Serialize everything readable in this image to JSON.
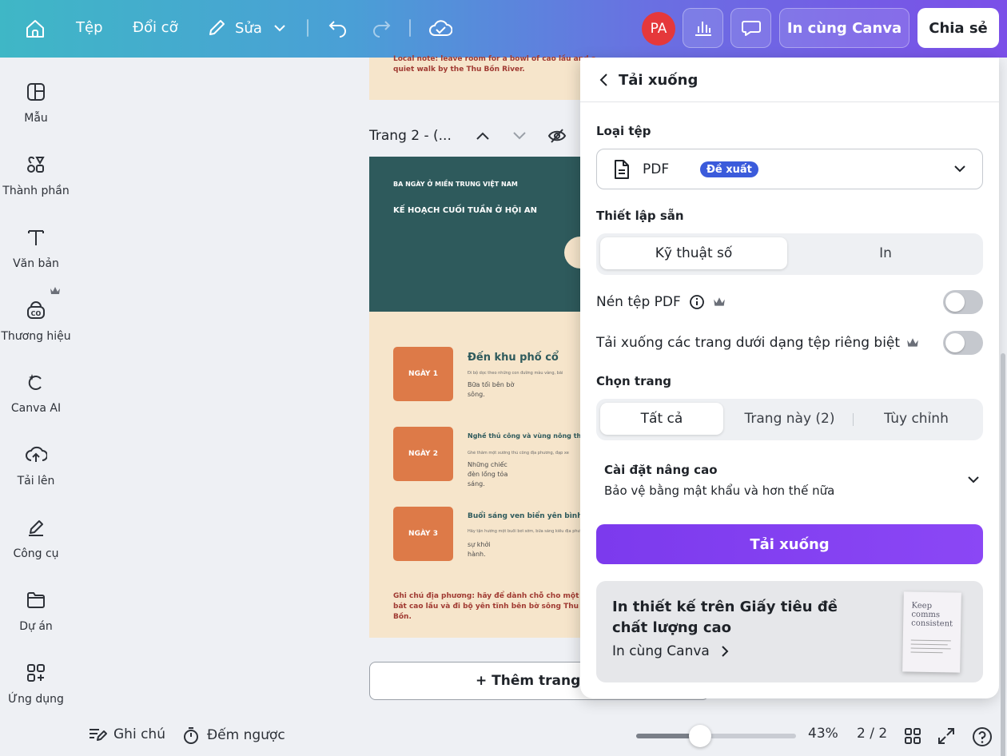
{
  "topbar": {
    "file": "Tệp",
    "resize": "Đổi cỡ",
    "edit": "Sửa",
    "avatar_initials": "PA",
    "print_btn": "In cùng Canva",
    "share_btn": "Chia sẻ"
  },
  "sidebar": {
    "items": [
      {
        "label": "Mẫu",
        "icon": "template-icon"
      },
      {
        "label": "Thành phần",
        "icon": "elements-icon"
      },
      {
        "label": "Văn bản",
        "icon": "text-icon"
      },
      {
        "label": "Thương hiệu",
        "icon": "brand-icon"
      },
      {
        "label": "Canva AI",
        "icon": "ai-icon"
      },
      {
        "label": "Tải lên",
        "icon": "upload-icon"
      },
      {
        "label": "Công cụ",
        "icon": "tools-icon"
      },
      {
        "label": "Dự án",
        "icon": "folder-icon"
      },
      {
        "label": "Ứng dụng",
        "icon": "apps-icon"
      }
    ]
  },
  "canvas": {
    "page1_note": "Local note: leave room for a bowl of cao lầu and a quiet walk by the Thu Bồn River.",
    "page2_title": "Trang 2 - (...",
    "page2": {
      "kicker": "BA NGÀY Ở MIỀN TRUNG VIỆT NAM",
      "title": "KẾ HOẠCH CUỐI TUẦN Ở HỘI AN",
      "days": [
        {
          "tag": "NGÀY 1",
          "heading": "Đến khu phố cổ",
          "small": "Đi bộ dọc theo những con đường màu vàng, bãi",
          "text": "Bữa tối bên bờ sông."
        },
        {
          "tag": "NGÀY 2",
          "heading": "Nghề thủ công và vùng nông thôn",
          "small": "Ghé thăm một xưởng thủ công địa phương, đạp xe",
          "text": "Những chiếc đèn lồng tỏa sáng."
        },
        {
          "tag": "NGÀY 3",
          "heading": "Buổi sáng ven biển yên bình",
          "small": "Hãy tận hưởng một buổi bơi sớm, bữa sáng kiểu địa phương và điểm dừng",
          "text": "sự khởi hành."
        }
      ],
      "note": "Ghi chú địa phương: hãy để dành chỗ cho một bát cao lầu và đi bộ yên tĩnh bên bờ sông Thu Bồn."
    },
    "add_page": "+ Thêm trang"
  },
  "bottombar": {
    "notes": "Ghi chú",
    "timer": "Đếm ngược",
    "zoom_level": "43%",
    "zoom_fraction": 0.4,
    "page_count": "2 / 2"
  },
  "download_panel": {
    "title": "Tải xuống",
    "file_type_label": "Loại tệp",
    "file_type_value": "PDF",
    "file_type_badge": "Đề xuất",
    "preset_label": "Thiết lập sẵn",
    "preset_options": [
      "Kỹ thuật số",
      "In"
    ],
    "compress_label": "Nén tệp PDF",
    "separate_label": "Tải xuống các trang dưới dạng tệp riêng biệt",
    "pages_label": "Chọn trang",
    "page_options": [
      "Tất cả",
      "Trang này (2)",
      "Tùy chỉnh"
    ],
    "advanced_title": "Cài đặt nâng cao",
    "advanced_sub": "Bảo vệ bằng mật khẩu và hơn thế nữa",
    "download_btn": "Tải xuống",
    "promo_title": "In thiết kế trên Giấy tiêu đề chất lượng cao",
    "promo_link": "In cùng Canva",
    "promo_image_text": "Keep comms consistent"
  },
  "colors": {
    "accent_purple": "#7c3aed",
    "badge_blue": "#3b5bdb",
    "avatar_red": "#e5383b",
    "page_teal": "#2e5a5c",
    "page_cream": "#f6e5cb",
    "day_orange": "#dd7a48"
  }
}
